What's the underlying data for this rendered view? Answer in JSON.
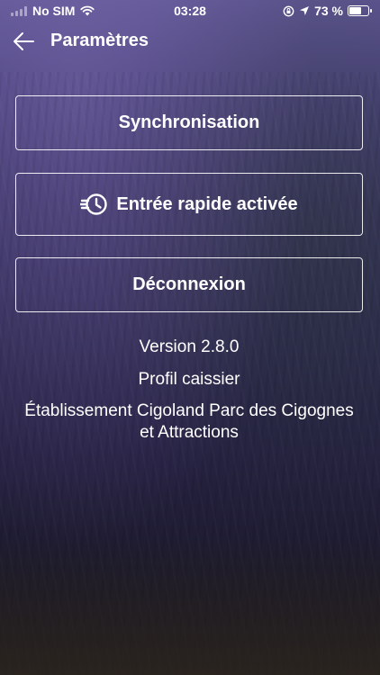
{
  "status_bar": {
    "carrier": "No SIM",
    "time": "03:28",
    "battery": "73 %",
    "battery_level": 0.73,
    "icons": [
      "wifi-icon",
      "orientation-lock-icon",
      "location-arrow-icon",
      "battery-icon"
    ]
  },
  "nav": {
    "title": "Paramètres",
    "back_icon": "back-arrow-icon"
  },
  "buttons": {
    "sync": "Synchronisation",
    "quick_entry": "Entrée rapide activée",
    "quick_entry_icon": "fast-clock-icon",
    "logout": "Déconnexion"
  },
  "info": {
    "version": "Version 2.8.0",
    "profile": "Profil caissier",
    "establishment": "Établissement Cigoland Parc des Cigognes et Attractions"
  },
  "colors": {
    "background_top": "#5e5593",
    "background_bottom": "#1d1a22",
    "text": "#ffffff"
  }
}
